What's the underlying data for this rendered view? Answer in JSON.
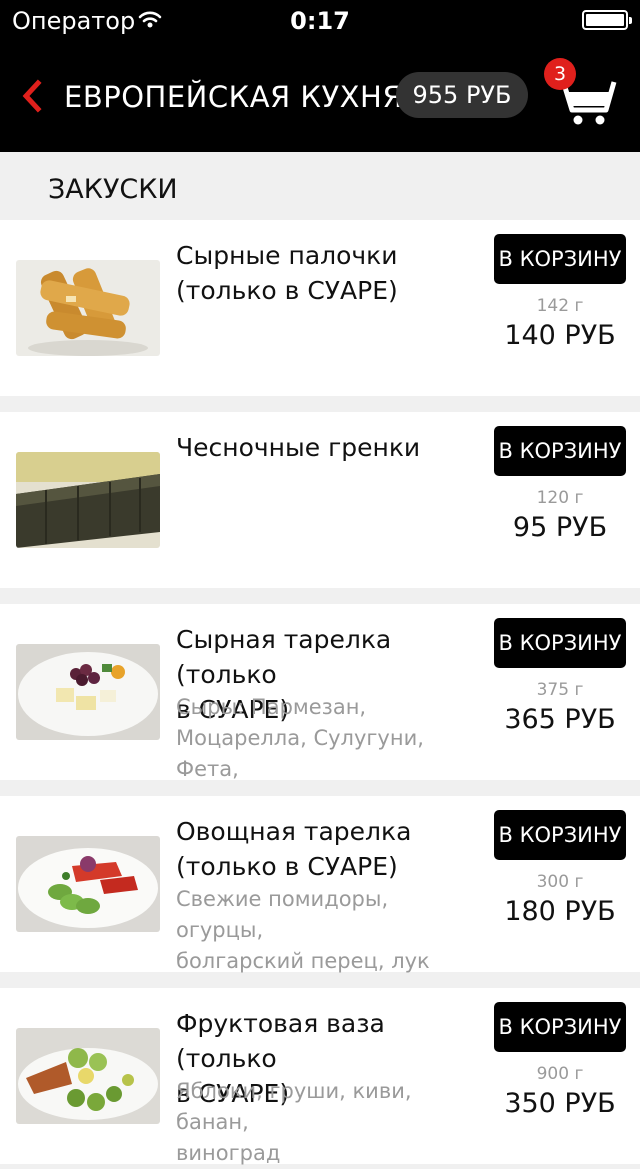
{
  "status_bar": {
    "carrier": "Оператор",
    "time": "0:17"
  },
  "header": {
    "title": "ЕВРОПЕЙСКАЯ КУХНЯ",
    "total": "955 РУБ",
    "cart_count": "3"
  },
  "section": {
    "title": "ЗАКУСКИ"
  },
  "items": [
    {
      "name_l1": "Сырные палочки",
      "name_l2": "(только в СУАРЕ)",
      "desc_l1": "",
      "desc_l2": "",
      "button": "В КОРЗИНУ",
      "weight": "142 г",
      "price": "140 РУБ"
    },
    {
      "name_l1": "Чесночные гренки",
      "name_l2": "",
      "desc_l1": "",
      "desc_l2": "",
      "button": "В КОРЗИНУ",
      "weight": "120 г",
      "price": "95 РУБ"
    },
    {
      "name_l1": "Сырная тарелка (только",
      "name_l2": "в СУАРЕ)",
      "desc_l1": "Сыры: Пармезан,",
      "desc_l2": "Моцарелла, Сулугуни, Фета,",
      "button": "В КОРЗИНУ",
      "weight": "375 г",
      "price": "365 РУБ"
    },
    {
      "name_l1": "Овощная тарелка",
      "name_l2": "(только в СУАРЕ)",
      "desc_l1": "Свежие помидоры, огурцы,",
      "desc_l2": "болгарский перец, лук",
      "button": "В КОРЗИНУ",
      "weight": "300 г",
      "price": "180 РУБ"
    },
    {
      "name_l1": "Фруктовая ваза (только",
      "name_l2": "в СУАРЕ)",
      "desc_l1": "Яблоки, груши, киви, банан,",
      "desc_l2": "виноград",
      "button": "В КОРЗИНУ",
      "weight": "900 г",
      "price": "350 РУБ"
    }
  ],
  "colors": {
    "accent": "#e0201c",
    "navbar": "#000000",
    "pill": "#333333",
    "background": "#f0f0f0"
  },
  "icons": [
    "wifi-icon",
    "battery-icon",
    "back-chevron-icon",
    "cart-icon"
  ]
}
